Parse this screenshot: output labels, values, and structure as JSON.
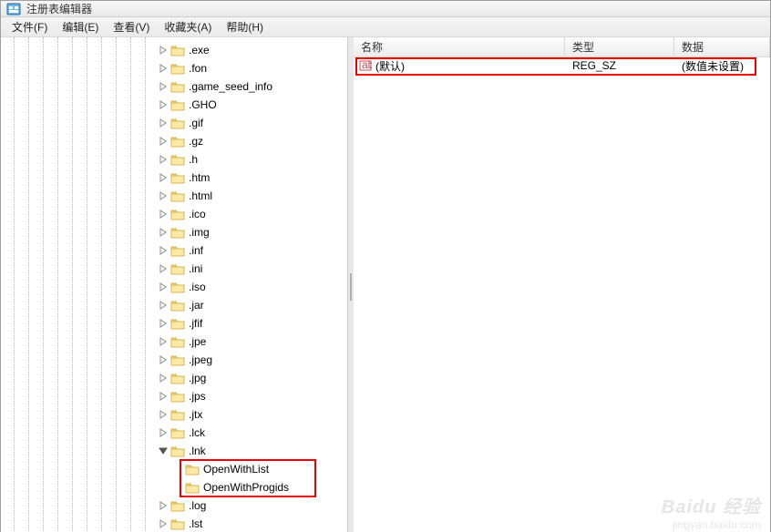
{
  "window": {
    "title": "注册表编辑器"
  },
  "menu": {
    "file": "文件(F)",
    "edit": "编辑(E)",
    "view": "查看(V)",
    "favorites": "收藏夹(A)",
    "help": "帮助(H)"
  },
  "tree": {
    "items": [
      ".exe",
      ".fon",
      ".game_seed_info",
      ".GHO",
      ".gif",
      ".gz",
      ".h",
      ".htm",
      ".html",
      ".ico",
      ".img",
      ".inf",
      ".ini",
      ".iso",
      ".jar",
      ".jfif",
      ".jpe",
      ".jpeg",
      ".jpg",
      ".jps",
      ".jtx",
      ".lck",
      ".lnk",
      ".log",
      ".lst"
    ],
    "expanded_index": 22,
    "children": [
      "OpenWithList",
      "OpenWithProgids"
    ]
  },
  "columns": {
    "name": "名称",
    "type": "类型",
    "data": "数据"
  },
  "rows": [
    {
      "name": "(默认)",
      "type": "REG_SZ",
      "data": "(数值未设置)"
    }
  ],
  "watermark": {
    "brand": "Baidu 经验",
    "url": "jingyan.baidu.com"
  }
}
